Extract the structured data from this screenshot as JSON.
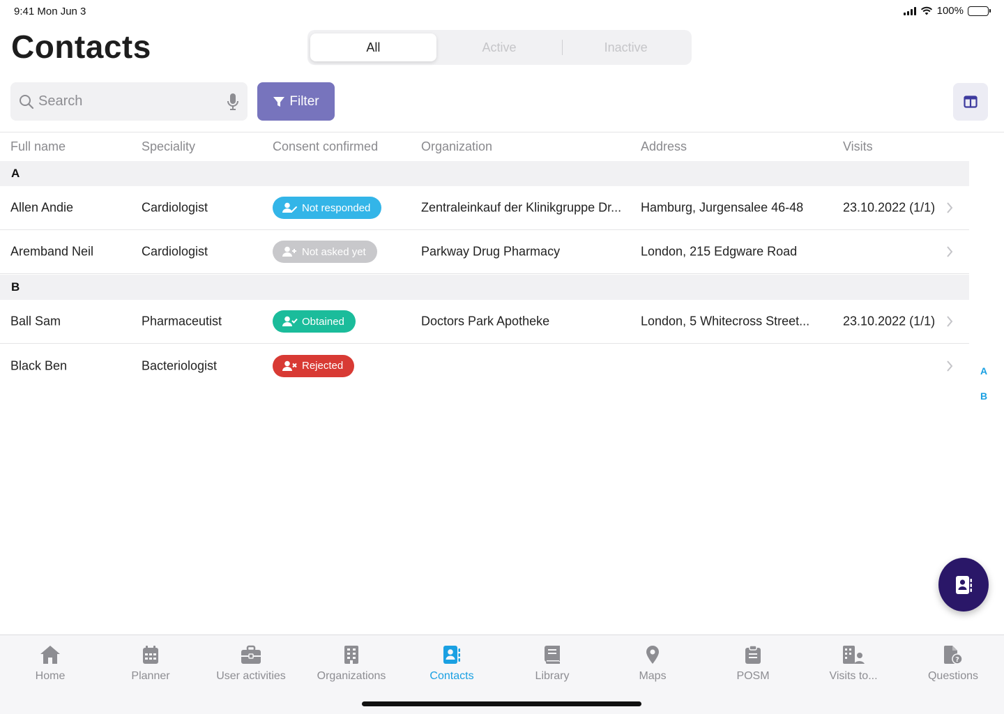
{
  "status_bar": {
    "time": "9:41  Mon Jun 3",
    "battery": "100%"
  },
  "page": {
    "title": "Contacts"
  },
  "segments": [
    {
      "label": "All",
      "active": true
    },
    {
      "label": "Active",
      "active": false
    },
    {
      "label": "Inactive",
      "active": false
    }
  ],
  "search": {
    "placeholder": "Search",
    "value": ""
  },
  "toolbar": {
    "filter_label": "Filter"
  },
  "table": {
    "columns": [
      "Full name",
      "Speciality",
      "Consent confirmed",
      "Organization",
      "Address",
      "Visits"
    ],
    "sections": [
      {
        "letter": "A",
        "rows": [
          {
            "name": "Allen Andie",
            "speciality": "Cardiologist",
            "consent": "Not responded",
            "consent_color": "#33b5e8",
            "organization": "Zentraleinkauf der Klinikgruppe Dr...",
            "address": "Hamburg, Jurgensalee 46-48",
            "visits": "23.10.2022 (1/1)"
          },
          {
            "name": "Aremband Neil",
            "speciality": "Cardiologist",
            "consent": "Not asked yet",
            "consent_color": "#c8c8cb",
            "organization": "Parkway Drug Pharmacy",
            "address": "London, 215 Edgware Road",
            "visits": ""
          }
        ]
      },
      {
        "letter": "B",
        "rows": [
          {
            "name": "Ball Sam",
            "speciality": "Pharmaceutist",
            "consent": "Obtained",
            "consent_color": "#1bbc9b",
            "organization": "Doctors Park Apotheke",
            "address": "London, 5 Whitecross Street...",
            "visits": "23.10.2022 (1/1)"
          },
          {
            "name": "Black Ben",
            "speciality": "Bacteriologist",
            "consent": "Rejected",
            "consent_color": "#d83a34",
            "organization": "",
            "address": "",
            "visits": ""
          }
        ]
      }
    ]
  },
  "index": [
    "A",
    "B"
  ],
  "tabs": [
    {
      "label": "Home",
      "icon": "home-icon",
      "active": false
    },
    {
      "label": "Planner",
      "icon": "calendar-icon",
      "active": false
    },
    {
      "label": "User activities",
      "icon": "briefcase-icon",
      "active": false
    },
    {
      "label": "Organizations",
      "icon": "building-icon",
      "active": false
    },
    {
      "label": "Contacts",
      "icon": "contacts-icon",
      "active": true
    },
    {
      "label": "Library",
      "icon": "book-icon",
      "active": false
    },
    {
      "label": "Maps",
      "icon": "map-pin-icon",
      "active": false
    },
    {
      "label": "POSM",
      "icon": "clipboard-icon",
      "active": false
    },
    {
      "label": "Visits to...",
      "icon": "building-person-icon",
      "active": false
    },
    {
      "label": "Questions",
      "icon": "document-question-icon",
      "active": false
    }
  ],
  "colors": {
    "accent": "#1aa0e2",
    "filter": "#7774bd",
    "fab": "#2a1768"
  }
}
